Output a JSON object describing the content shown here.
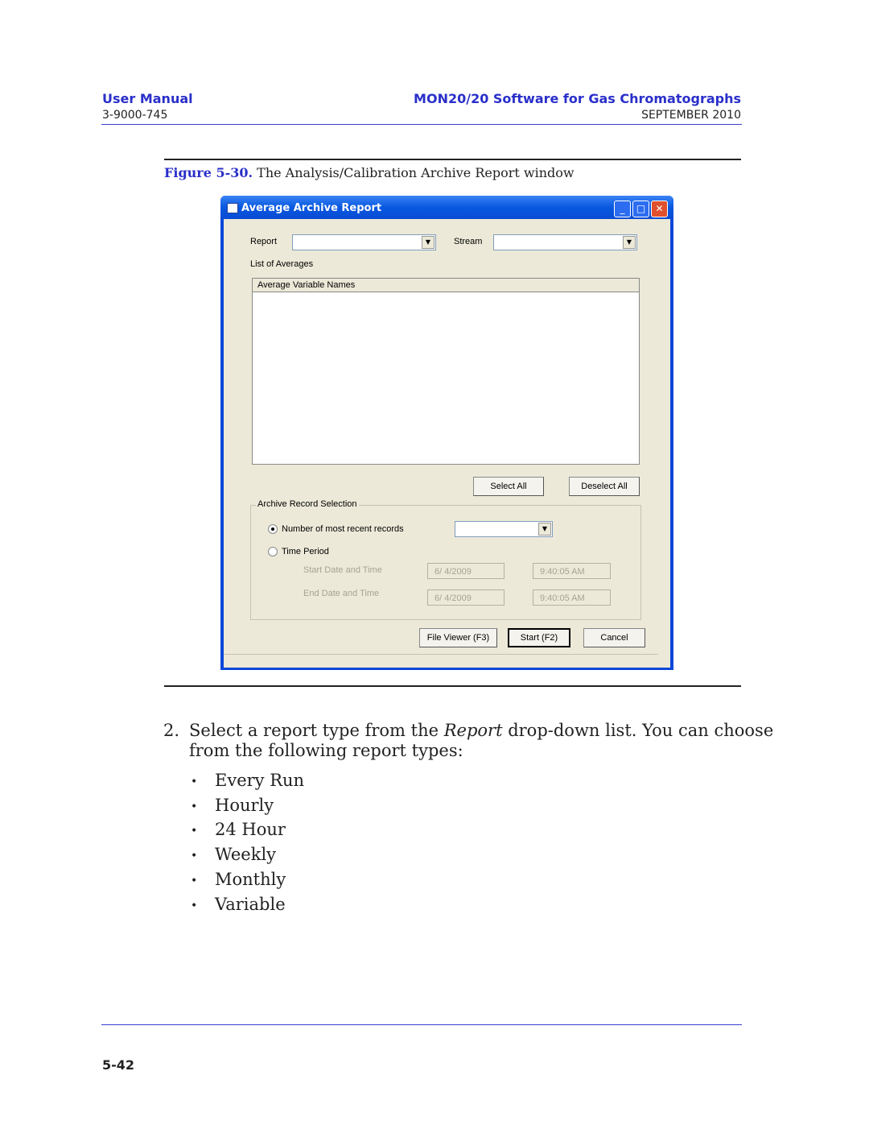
{
  "header": {
    "left_title": "User Manual",
    "doc_number": "3-9000-745",
    "right_title": "MON20/20 Software for Gas Chromatographs",
    "date": "SEPTEMBER 2010"
  },
  "figure": {
    "label": "Figure 5-30.",
    "caption": "The Analysis/Calibration Archive Report window"
  },
  "window": {
    "title": "Average Archive Report",
    "report_label": "Report",
    "report_value": "",
    "stream_label": "Stream",
    "stream_value": "",
    "list_label": "List of Averages",
    "list_column": "Average Variable Names",
    "select_all": "Select All",
    "deselect_all": "Deselect All",
    "group_label": "Archive Record Selection",
    "radio_recent": "Number of most recent records",
    "radio_recent_selected": true,
    "radio_time": "Time Period",
    "start_label": "Start Date and Time",
    "end_label": "End Date and Time",
    "start_date": "6/  4/2009",
    "start_time": "9:40:05 AM",
    "end_date": "6/  4/2009",
    "end_time": "9:40:05 AM",
    "file_viewer": "File Viewer (F3)",
    "start": "Start (F2)",
    "cancel": "Cancel"
  },
  "body": {
    "step_number": "2.",
    "step_text_1": "Select a report type from the ",
    "step_text_em": "Report",
    "step_text_2": " drop-down list.  You can choose",
    "step_text_3": "from the following report types:",
    "report_types": [
      "Every Run",
      "Hourly",
      "24 Hour",
      "Weekly",
      "Monthly",
      "Variable"
    ]
  },
  "footer": {
    "page_number": "5-42"
  }
}
